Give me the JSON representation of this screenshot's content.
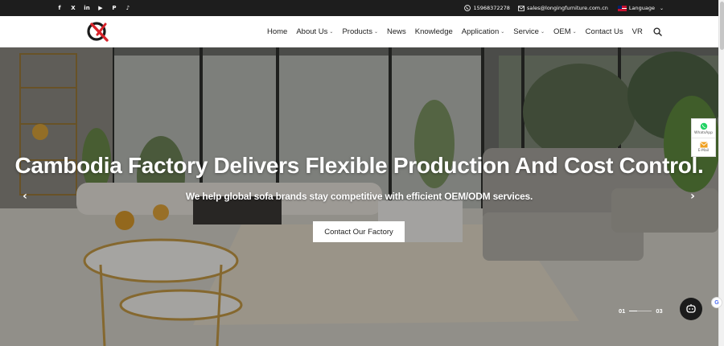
{
  "topbar": {
    "social_icons": [
      "facebook-icon",
      "x-icon",
      "linkedin-icon",
      "youtube-icon",
      "pinterest-icon",
      "tiktok-icon"
    ],
    "social_glyphs": [
      "f",
      "X",
      "in",
      "▶",
      "P",
      "♪"
    ],
    "phone": "15968372278",
    "email": "sales@longingfurniture.com.cn",
    "language_label": "Language"
  },
  "nav": {
    "items": [
      {
        "label": "Home",
        "dropdown": false
      },
      {
        "label": "About Us",
        "dropdown": true
      },
      {
        "label": "Products",
        "dropdown": true
      },
      {
        "label": "News",
        "dropdown": false
      },
      {
        "label": "Knowledge",
        "dropdown": false
      },
      {
        "label": "Application",
        "dropdown": true
      },
      {
        "label": "Service",
        "dropdown": true
      },
      {
        "label": "OEM",
        "dropdown": true
      },
      {
        "label": "Contact Us",
        "dropdown": false
      },
      {
        "label": "VR",
        "dropdown": false
      }
    ]
  },
  "hero": {
    "title": "Cambodia Factory Delivers Flexible Production And Cost Control.",
    "subtitle": "We help global sofa brands stay competitive with efficient OEM/ODM services.",
    "cta_label": "Contact Our Factory",
    "prev_glyph": "‹",
    "next_glyph": "›",
    "pager": {
      "current": "01",
      "total": "03",
      "progress": 0.33
    }
  },
  "float_widget": {
    "whatsapp_label": "WhatsApp",
    "email_label": "E-Mail"
  },
  "colors": {
    "topbar_bg": "#1d1d1d",
    "logo_red": "#d8232a",
    "cta_bg": "#ffffff",
    "whatsapp_green": "#25d366",
    "email_orange": "#f0a020"
  }
}
